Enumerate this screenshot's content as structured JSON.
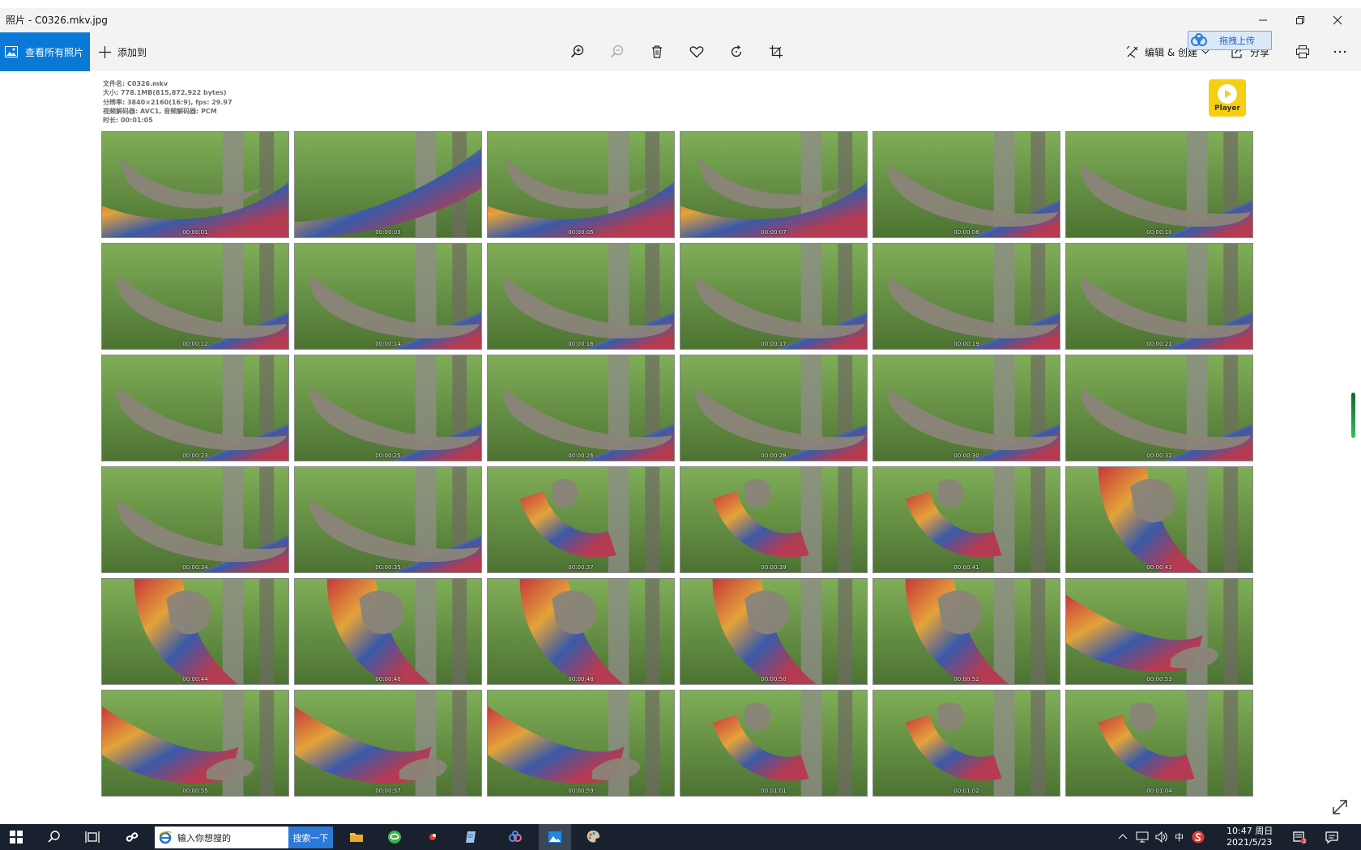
{
  "window": {
    "title": "照片 - C0326.mkv.jpg"
  },
  "toolbar": {
    "view_all_label": "查看所有照片",
    "add_to_label": "添加到",
    "edit_create_label": "编辑 & 创建",
    "share_label": "分享",
    "tools": [
      "zoom-in",
      "zoom-out",
      "delete",
      "favorite",
      "rotate",
      "crop"
    ]
  },
  "upload_badge": {
    "label": "拖拽上传"
  },
  "file_info": {
    "lines": [
      "文件名: C0326.mkv",
      "大小: 778.1MB(815,872,922 bytes)",
      "分辨率: 3840×2160(16:9), fps: 29.97",
      "视频解码器: AVC1, 音频解码器: PCM",
      "时长: 00:01:05"
    ]
  },
  "player_badge": {
    "label": "Player"
  },
  "thumbnails": [
    {
      "time": "00:00:01",
      "scene": "legs-wide"
    },
    {
      "time": "00:00:03",
      "scene": "hammock-only"
    },
    {
      "time": "00:00:05",
      "scene": "legs-wide"
    },
    {
      "time": "00:00:07",
      "scene": "legs-wide"
    },
    {
      "time": "00:00:08",
      "scene": "legs-close"
    },
    {
      "time": "00:00:10",
      "scene": "legs-close"
    },
    {
      "time": "00:00:12",
      "scene": "legs-close"
    },
    {
      "time": "00:00:14",
      "scene": "legs-close"
    },
    {
      "time": "00:00:16",
      "scene": "legs-close"
    },
    {
      "time": "00:00:17",
      "scene": "legs-close"
    },
    {
      "time": "00:00:19",
      "scene": "legs-close"
    },
    {
      "time": "00:00:21",
      "scene": "legs-close"
    },
    {
      "time": "00:00:23",
      "scene": "legs-close"
    },
    {
      "time": "00:00:25",
      "scene": "legs-close"
    },
    {
      "time": "00:00:26",
      "scene": "legs-close"
    },
    {
      "time": "00:00:28",
      "scene": "legs-close"
    },
    {
      "time": "00:00:30",
      "scene": "legs-close"
    },
    {
      "time": "00:00:32",
      "scene": "legs-close"
    },
    {
      "time": "00:00:34",
      "scene": "legs-close"
    },
    {
      "time": "00:00:35",
      "scene": "legs-close"
    },
    {
      "time": "00:00:37",
      "scene": "person-hammock"
    },
    {
      "time": "00:00:39",
      "scene": "person-hammock"
    },
    {
      "time": "00:00:41",
      "scene": "person-hammock"
    },
    {
      "time": "00:00:43",
      "scene": "person-close"
    },
    {
      "time": "00:00:44",
      "scene": "person-close"
    },
    {
      "time": "00:00:46",
      "scene": "person-close"
    },
    {
      "time": "00:00:48",
      "scene": "person-close"
    },
    {
      "time": "00:00:50",
      "scene": "person-close"
    },
    {
      "time": "00:00:52",
      "scene": "person-close"
    },
    {
      "time": "00:00:53",
      "scene": "feet-hammock"
    },
    {
      "time": "00:00:55",
      "scene": "feet-hammock"
    },
    {
      "time": "00:00:57",
      "scene": "feet-hammock"
    },
    {
      "time": "00:00:59",
      "scene": "feet-hammock"
    },
    {
      "time": "00:01:01",
      "scene": "person-hammock"
    },
    {
      "time": "00:01:02",
      "scene": "person-hammock"
    },
    {
      "time": "00:01:04",
      "scene": "person-hammock"
    }
  ],
  "taskbar": {
    "search_placeholder": "输入你想搜的",
    "search_button": "搜索一下",
    "ime_label": "中",
    "time": "10:47 周日",
    "date": "2021/5/23",
    "notification_count": "2"
  },
  "colors": {
    "accent": "#0a79d6",
    "toolbar_bg": "#f3f3f3",
    "taskbar_bg": "#19212e",
    "player_yellow": "#f4cf12"
  }
}
